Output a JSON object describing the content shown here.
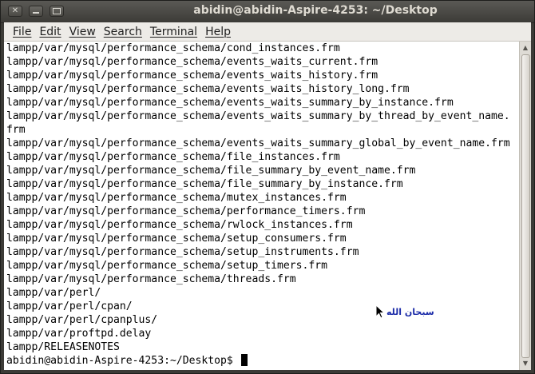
{
  "window": {
    "title": "abidin@abidin-Aspire-4253: ~/Desktop"
  },
  "menubar": {
    "items": [
      {
        "label": "File"
      },
      {
        "label": "Edit"
      },
      {
        "label": "View"
      },
      {
        "label": "Search"
      },
      {
        "label": "Terminal"
      },
      {
        "label": "Help"
      }
    ]
  },
  "terminal": {
    "lines": [
      "lampp/var/mysql/performance_schema/cond_instances.frm",
      "lampp/var/mysql/performance_schema/events_waits_current.frm",
      "lampp/var/mysql/performance_schema/events_waits_history.frm",
      "lampp/var/mysql/performance_schema/events_waits_history_long.frm",
      "lampp/var/mysql/performance_schema/events_waits_summary_by_instance.frm",
      "lampp/var/mysql/performance_schema/events_waits_summary_by_thread_by_event_name.",
      "frm",
      "lampp/var/mysql/performance_schema/events_waits_summary_global_by_event_name.frm",
      "lampp/var/mysql/performance_schema/file_instances.frm",
      "lampp/var/mysql/performance_schema/file_summary_by_event_name.frm",
      "lampp/var/mysql/performance_schema/file_summary_by_instance.frm",
      "lampp/var/mysql/performance_schema/mutex_instances.frm",
      "lampp/var/mysql/performance_schema/performance_timers.frm",
      "lampp/var/mysql/performance_schema/rwlock_instances.frm",
      "lampp/var/mysql/performance_schema/setup_consumers.frm",
      "lampp/var/mysql/performance_schema/setup_instruments.frm",
      "lampp/var/mysql/performance_schema/setup_timers.frm",
      "lampp/var/mysql/performance_schema/threads.frm",
      "lampp/var/perl/",
      "lampp/var/perl/cpan/",
      "lampp/var/perl/cpanplus/",
      "lampp/var/proftpd.delay",
      "lampp/RELEASENOTES"
    ],
    "prompt": "abidin@abidin-Aspire-4253:~/Desktop$ "
  },
  "overlay": {
    "text": "سبحان الله"
  },
  "icons": {
    "close": "close-icon",
    "minimize": "minimize-icon",
    "maximize": "maximize-icon",
    "pointer": "mouse-pointer-icon"
  }
}
